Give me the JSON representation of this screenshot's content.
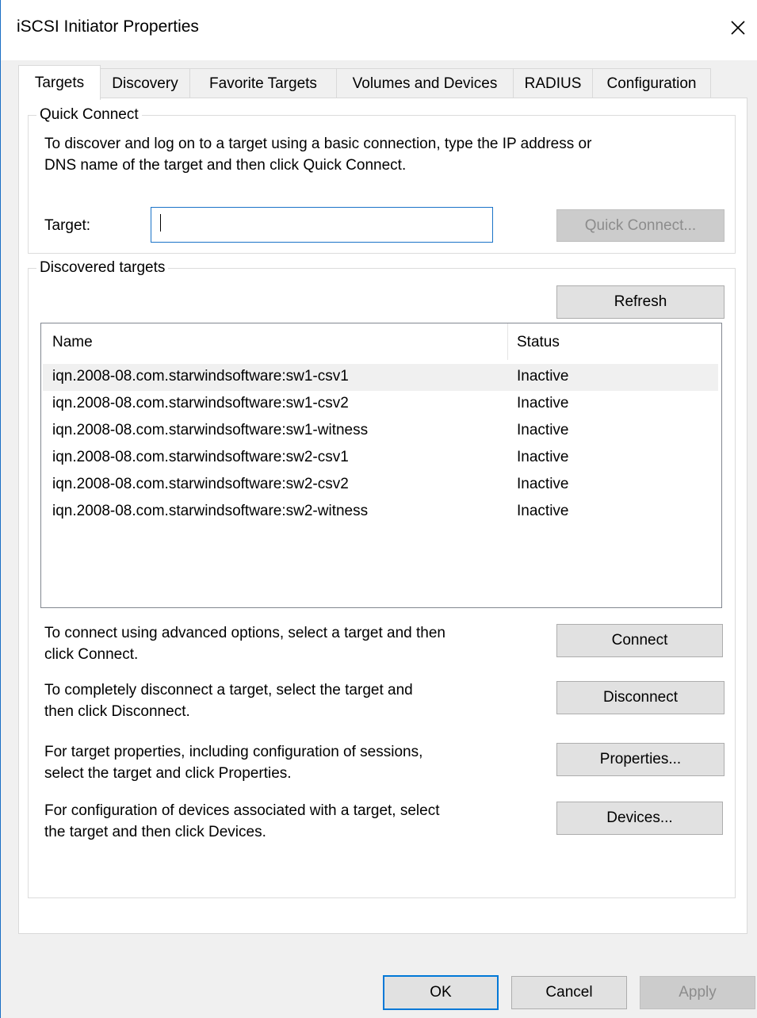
{
  "window": {
    "title": "iSCSI Initiator Properties",
    "close_icon": "close-icon"
  },
  "tabs": [
    {
      "label": "Targets",
      "active": true
    },
    {
      "label": "Discovery"
    },
    {
      "label": "Favorite Targets"
    },
    {
      "label": "Volumes and Devices"
    },
    {
      "label": "RADIUS"
    },
    {
      "label": "Configuration"
    }
  ],
  "quick_connect": {
    "legend": "Quick Connect",
    "instructions_line1": "To discover and log on to a target using a basic connection, type the IP address or",
    "instructions_line2": "DNS name of the target and then click Quick Connect.",
    "target_label": "Target:",
    "target_value": "",
    "button_label": "Quick Connect..."
  },
  "discovered": {
    "legend": "Discovered targets",
    "refresh_label": "Refresh",
    "columns": {
      "name": "Name",
      "status": "Status"
    },
    "rows": [
      {
        "name": "iqn.2008-08.com.starwindsoftware:sw1-csv1",
        "status": "Inactive"
      },
      {
        "name": "iqn.2008-08.com.starwindsoftware:sw1-csv2",
        "status": "Inactive"
      },
      {
        "name": "iqn.2008-08.com.starwindsoftware:sw1-witness",
        "status": "Inactive"
      },
      {
        "name": "iqn.2008-08.com.starwindsoftware:sw2-csv1",
        "status": "Inactive"
      },
      {
        "name": "iqn.2008-08.com.starwindsoftware:sw2-csv2",
        "status": "Inactive"
      },
      {
        "name": "iqn.2008-08.com.starwindsoftware:sw2-witness",
        "status": "Inactive"
      }
    ],
    "actions": [
      {
        "text_line1": "To connect using advanced options, select a target and then",
        "text_line2": "click Connect.",
        "button": "Connect"
      },
      {
        "text_line1": "To completely disconnect a target, select the target and",
        "text_line2": "then click Disconnect.",
        "button": "Disconnect"
      },
      {
        "text_line1": "For target properties, including configuration of sessions,",
        "text_line2": "select the target and click Properties.",
        "button": "Properties..."
      },
      {
        "text_line1": "For configuration of devices associated with a target, select",
        "text_line2": "the target and then click Devices.",
        "button": "Devices..."
      }
    ]
  },
  "footer": {
    "ok": "OK",
    "cancel": "Cancel",
    "apply": "Apply"
  },
  "colors": {
    "accent": "#0078d7",
    "window_border": "#1a6fc4"
  }
}
